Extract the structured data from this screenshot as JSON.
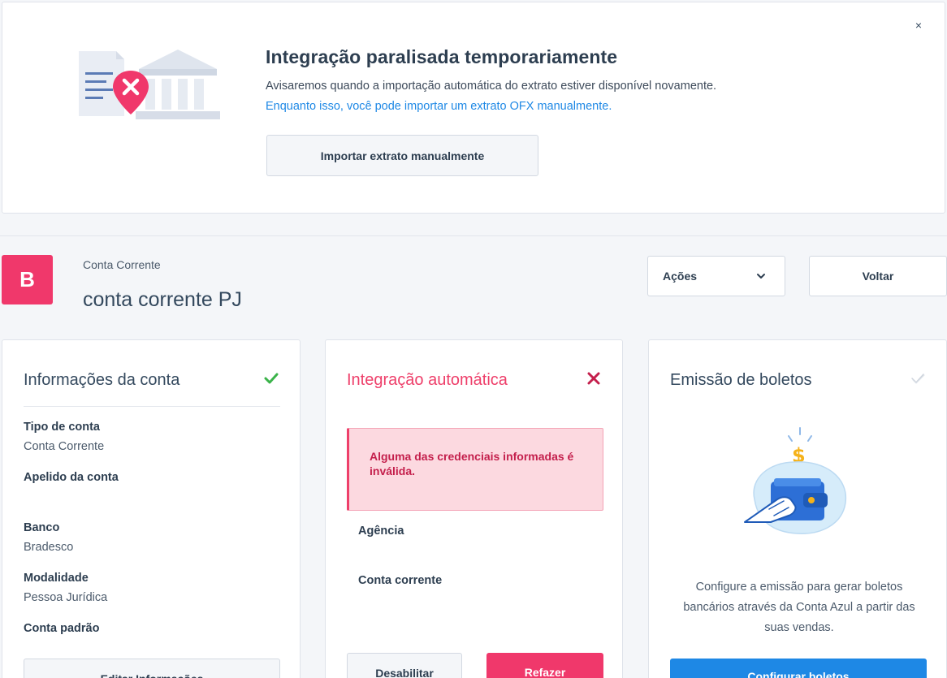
{
  "banner": {
    "title": "Integração paralisada temporariamente",
    "message": "Avisaremos quando a importação automática do extrato estiver disponível novamente.",
    "link": "Enquanto isso, você pode importar um extrato OFX manualmente.",
    "button": "Importar extrato manualmente",
    "close": "×"
  },
  "account": {
    "bank_initial": "B",
    "type": "Conta Corrente",
    "name": "conta corrente PJ",
    "actions_label": "Ações",
    "back_label": "Voltar"
  },
  "info_card": {
    "title": "Informações da conta",
    "status_icon": "check-icon",
    "status_color": "#3bb34a",
    "fields": [
      {
        "label": "Tipo de conta",
        "value": "Conta Corrente"
      },
      {
        "label": "Apelido da conta",
        "value": ""
      },
      {
        "label": "Banco",
        "value": "Bradesco"
      },
      {
        "label": "Modalidade",
        "value": "Pessoa Jurídica"
      },
      {
        "label": "Conta padrão",
        "value": ""
      }
    ],
    "button": "Editar Informações"
  },
  "integration_card": {
    "title": "Integração automática",
    "status_icon": "x-icon",
    "status_color": "#c41f4c",
    "alert": "Alguma das credenciais informadas é inválida.",
    "fields": [
      {
        "label": "Agência"
      },
      {
        "label": "Conta corrente"
      }
    ],
    "disable_button": "Desabilitar",
    "redo_button": "Refazer"
  },
  "boleto_card": {
    "title": "Emissão de boletos",
    "status_icon": "check-outline-icon",
    "description": "Configure a emissão para gerar boletos bancários através da Conta Azul a partir das suas vendas.",
    "button": "Configurar boletos"
  },
  "colors": {
    "accent_pink": "#f0386b",
    "link_blue": "#1e88e5",
    "text_dark": "#2d3e50"
  }
}
